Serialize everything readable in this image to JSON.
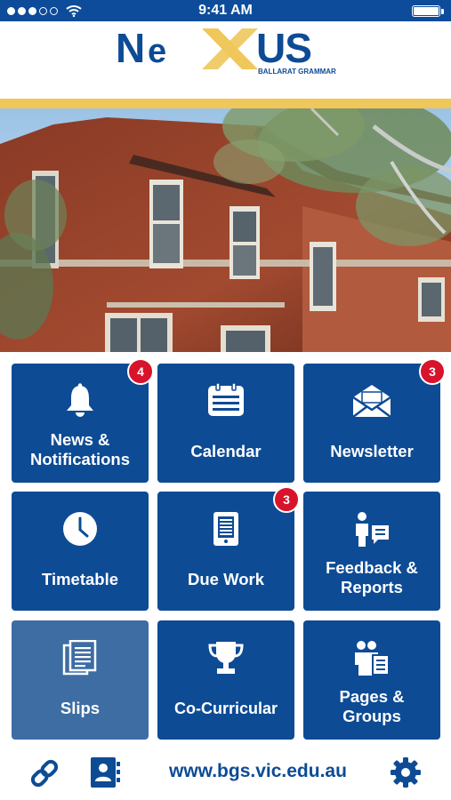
{
  "status_bar": {
    "time": "9:41 AM",
    "signal_dots": 5,
    "signal_filled": 3,
    "battery_level": 1.0
  },
  "header": {
    "logo_text": "NEXUS",
    "logo_subtitle": "BALLARAT GRAMMAR",
    "brand_color": "#0d4b95",
    "accent_color": "#f0c75a"
  },
  "hero": {
    "image": "red-brick school building with trees"
  },
  "tiles": [
    {
      "label": [
        "News &",
        "Notifications"
      ],
      "icon": "bell-icon",
      "badge": "4"
    },
    {
      "label": [
        "Calendar"
      ],
      "icon": "calendar-icon",
      "badge": ""
    },
    {
      "label": [
        "Newsletter"
      ],
      "icon": "envelope-icon",
      "badge": "3"
    },
    {
      "label": [
        "Timetable"
      ],
      "icon": "clock-icon",
      "badge": ""
    },
    {
      "label": [
        "Due Work"
      ],
      "icon": "tablet-icon",
      "badge": "3"
    },
    {
      "label": [
        "Feedback &",
        "Reports"
      ],
      "icon": "feedback-person-icon",
      "badge": ""
    },
    {
      "label": [
        "Slips"
      ],
      "icon": "documents-icon",
      "badge": ""
    },
    {
      "label": [
        "Co-Curricular"
      ],
      "icon": "trophy-icon",
      "badge": ""
    },
    {
      "label": [
        "Pages &",
        "Groups"
      ],
      "icon": "groups-icon",
      "badge": ""
    }
  ],
  "bottom_bar": {
    "url": "www.bgs.vic.edu.au",
    "link_icon": "link-icon",
    "contacts_icon": "contacts-icon",
    "settings_icon": "gear-icon"
  },
  "colors": {
    "tile": "#0d4b95",
    "tile_selected": "#3d6da3",
    "badge": "#d8132c"
  }
}
